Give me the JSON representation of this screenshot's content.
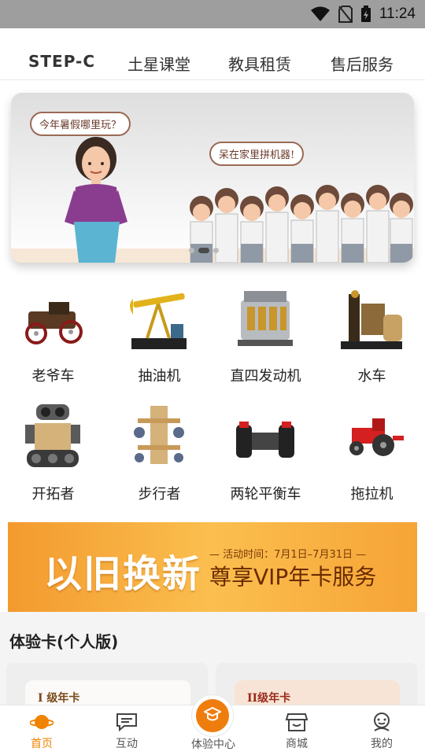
{
  "status_bar": {
    "time": "11:24"
  },
  "top_tabs": [
    {
      "label": "STEP-C",
      "active": true
    },
    {
      "label": "土星课堂",
      "active": false
    },
    {
      "label": "教具租赁",
      "active": false
    },
    {
      "label": "售后服务",
      "active": false
    }
  ],
  "banner": {
    "bubble_1": "今年暑假哪里玩？",
    "bubble_2": "呆在家里拼机器!"
  },
  "products": [
    {
      "label": "老爷车",
      "icon": "vintage-car-model"
    },
    {
      "label": "抽油机",
      "icon": "oil-pump-model"
    },
    {
      "label": "直四发动机",
      "icon": "inline-four-engine-model"
    },
    {
      "label": "水车",
      "icon": "water-wheel-model"
    },
    {
      "label": "开拓者",
      "icon": "robot-model"
    },
    {
      "label": "步行者",
      "icon": "walker-model"
    },
    {
      "label": "两轮平衡车",
      "icon": "balance-car-model"
    },
    {
      "label": "拖拉机",
      "icon": "tractor-model"
    }
  ],
  "promo": {
    "headline": "以旧换新",
    "date": "— 活动时间：7月1日–7月31日 —",
    "subline": "尊享VIP年卡服务"
  },
  "experience_cards": {
    "title": "体验卡(个人版)",
    "cards": [
      {
        "label": "I 级年卡"
      },
      {
        "label": "II级年卡"
      }
    ]
  },
  "bottom_nav": {
    "items": [
      {
        "label": "首页",
        "icon": "planet-icon",
        "active": true
      },
      {
        "label": "互动",
        "icon": "chat-icon",
        "active": false
      },
      {
        "label": "体验中心",
        "icon": "graduate-icon",
        "active": false
      },
      {
        "label": "商城",
        "icon": "store-icon",
        "active": false
      },
      {
        "label": "我的",
        "icon": "profile-icon",
        "active": false
      }
    ]
  },
  "colors": {
    "accent": "#f08300",
    "promo_orange": "#f39a2e",
    "status_bar": "#9e9e9e"
  }
}
